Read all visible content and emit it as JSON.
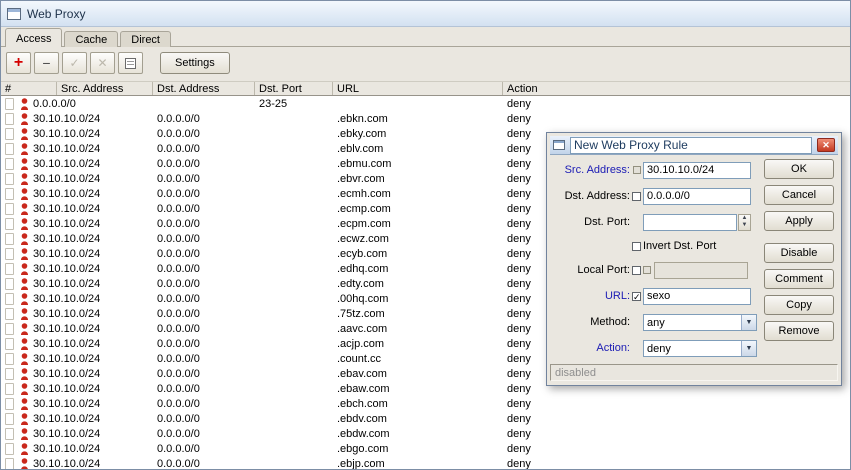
{
  "glyphs": {
    "plus": "+",
    "minus": "−",
    "check": "✓",
    "cross": "✕",
    "close": "✕",
    "dropdown": "▼",
    "spin_up": "▲",
    "spin_down": "▼"
  },
  "colors": {
    "label_accent": "#1b1bb4",
    "deny_icon": "#c9281c",
    "close_button": "#c43a22"
  },
  "window": {
    "title": "Web Proxy",
    "tabs": [
      "Access",
      "Cache",
      "Direct"
    ],
    "toolbar": {
      "settings_label": "Settings"
    }
  },
  "table": {
    "columns": {
      "num": "#",
      "src": "Src. Address",
      "dst": "Dst. Address",
      "port": "Dst. Port",
      "url": "URL",
      "action": "Action"
    },
    "rows": [
      {
        "src": "0.0.0.0/0",
        "dst": "",
        "port": "23-25",
        "url": "",
        "action": "deny"
      },
      {
        "src": "30.10.10.0/24",
        "dst": "0.0.0.0/0",
        "port": "",
        "url": ".ebkn.com",
        "action": "deny"
      },
      {
        "src": "30.10.10.0/24",
        "dst": "0.0.0.0/0",
        "port": "",
        "url": ".ebky.com",
        "action": "deny"
      },
      {
        "src": "30.10.10.0/24",
        "dst": "0.0.0.0/0",
        "port": "",
        "url": ".eblv.com",
        "action": "deny"
      },
      {
        "src": "30.10.10.0/24",
        "dst": "0.0.0.0/0",
        "port": "",
        "url": ".ebmu.com",
        "action": "deny"
      },
      {
        "src": "30.10.10.0/24",
        "dst": "0.0.0.0/0",
        "port": "",
        "url": ".ebvr.com",
        "action": "deny"
      },
      {
        "src": "30.10.10.0/24",
        "dst": "0.0.0.0/0",
        "port": "",
        "url": ".ecmh.com",
        "action": "deny"
      },
      {
        "src": "30.10.10.0/24",
        "dst": "0.0.0.0/0",
        "port": "",
        "url": ".ecmp.com",
        "action": "deny"
      },
      {
        "src": "30.10.10.0/24",
        "dst": "0.0.0.0/0",
        "port": "",
        "url": ".ecpm.com",
        "action": "deny"
      },
      {
        "src": "30.10.10.0/24",
        "dst": "0.0.0.0/0",
        "port": "",
        "url": ".ecwz.com",
        "action": "deny"
      },
      {
        "src": "30.10.10.0/24",
        "dst": "0.0.0.0/0",
        "port": "",
        "url": ".ecyb.com",
        "action": "deny"
      },
      {
        "src": "30.10.10.0/24",
        "dst": "0.0.0.0/0",
        "port": "",
        "url": ".edhq.com",
        "action": "deny"
      },
      {
        "src": "30.10.10.0/24",
        "dst": "0.0.0.0/0",
        "port": "",
        "url": ".edty.com",
        "action": "deny"
      },
      {
        "src": "30.10.10.0/24",
        "dst": "0.0.0.0/0",
        "port": "",
        "url": ".00hq.com",
        "action": "deny"
      },
      {
        "src": "30.10.10.0/24",
        "dst": "0.0.0.0/0",
        "port": "",
        "url": ".75tz.com",
        "action": "deny"
      },
      {
        "src": "30.10.10.0/24",
        "dst": "0.0.0.0/0",
        "port": "",
        "url": ".aavc.com",
        "action": "deny"
      },
      {
        "src": "30.10.10.0/24",
        "dst": "0.0.0.0/0",
        "port": "",
        "url": ".acjp.com",
        "action": "deny"
      },
      {
        "src": "30.10.10.0/24",
        "dst": "0.0.0.0/0",
        "port": "",
        "url": ".count.cc",
        "action": "deny"
      },
      {
        "src": "30.10.10.0/24",
        "dst": "0.0.0.0/0",
        "port": "",
        "url": ".ebav.com",
        "action": "deny"
      },
      {
        "src": "30.10.10.0/24",
        "dst": "0.0.0.0/0",
        "port": "",
        "url": ".ebaw.com",
        "action": "deny"
      },
      {
        "src": "30.10.10.0/24",
        "dst": "0.0.0.0/0",
        "port": "",
        "url": ".ebch.com",
        "action": "deny"
      },
      {
        "src": "30.10.10.0/24",
        "dst": "0.0.0.0/0",
        "port": "",
        "url": ".ebdv.com",
        "action": "deny"
      },
      {
        "src": "30.10.10.0/24",
        "dst": "0.0.0.0/0",
        "port": "",
        "url": ".ebdw.com",
        "action": "deny"
      },
      {
        "src": "30.10.10.0/24",
        "dst": "0.0.0.0/0",
        "port": "",
        "url": ".ebgo.com",
        "action": "deny"
      },
      {
        "src": "30.10.10.0/24",
        "dst": "0.0.0.0/0",
        "port": "",
        "url": ".ebjp.com",
        "action": "deny"
      }
    ]
  },
  "dialog": {
    "title": "New Web Proxy Rule",
    "fields": {
      "src_address": {
        "label": "Src. Address:",
        "value": "30.10.10.0/24"
      },
      "dst_address": {
        "label": "Dst. Address:",
        "value": "0.0.0.0/0",
        "checked": false
      },
      "dst_port": {
        "label": "Dst. Port:",
        "value": ""
      },
      "invert_dst_port": {
        "label": "Invert Dst. Port",
        "checked": false
      },
      "local_port": {
        "label": "Local Port:",
        "value": ""
      },
      "url": {
        "label": "URL:",
        "value": "sexo",
        "checked": true
      },
      "method": {
        "label": "Method:",
        "value": "any"
      },
      "action": {
        "label": "Action:",
        "value": "deny"
      }
    },
    "buttons": {
      "ok": "OK",
      "cancel": "Cancel",
      "apply": "Apply",
      "disable": "Disable",
      "comment": "Comment",
      "copy": "Copy",
      "remove": "Remove"
    },
    "status": "disabled"
  }
}
